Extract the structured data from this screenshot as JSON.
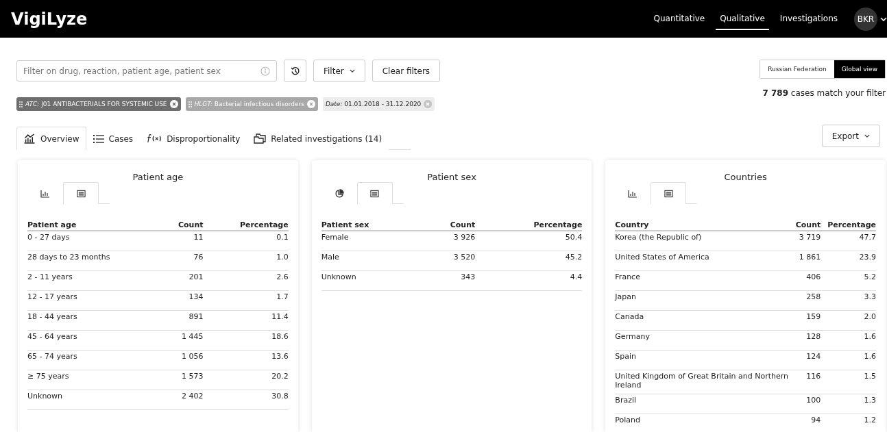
{
  "header": {
    "logo": "VigiLyze",
    "nav": [
      {
        "label": "Quantitative",
        "selected": false
      },
      {
        "label": "Qualitative",
        "selected": true
      },
      {
        "label": "Investigations",
        "selected": false
      }
    ],
    "avatar": "BKR"
  },
  "search": {
    "placeholder": "Filter on drug, reaction, patient age, patient sex"
  },
  "buttons": {
    "filter": "Filter",
    "clear": "Clear filters"
  },
  "scope": [
    {
      "label": "Russian Federation",
      "selected": false
    },
    {
      "label": "Global view",
      "selected": true
    }
  ],
  "match_count": "**7 789** cases match your filter",
  "chips": [
    {
      "prefix": "ATC:",
      "value": "J01 ANTIBACTERIALS FOR SYSTEMIC USE",
      "color": "#6e6e6e",
      "draggable": true
    },
    {
      "prefix": "HLGT:",
      "value": "Bacterial infectious disorders",
      "color": "#a8a8a8",
      "draggable": true
    },
    {
      "prefix": "Date:",
      "value": "01.01.2018 - 31.12.2020",
      "color": "#ececec",
      "draggable": false
    }
  ],
  "tabs": [
    {
      "kind": "overview",
      "label": "Overview",
      "selected": true
    },
    {
      "kind": "cases",
      "label": "Cases",
      "selected": false
    },
    {
      "kind": "function",
      "label": "Disproportionality",
      "selected": false
    },
    {
      "kind": "folders",
      "label": "Related investigations (14)",
      "selected": false
    }
  ],
  "export": "Export",
  "cards": [
    {
      "title": "Patient age",
      "views": [
        {
          "kind": "bar",
          "selected": false
        },
        {
          "kind": "table",
          "selected": true
        }
      ],
      "columns": [
        "Patient age",
        "Count",
        "Percentage"
      ],
      "rows": [
        [
          "0 - 27 days",
          "11",
          "0.1"
        ],
        [
          "28 days to 23 months",
          "76",
          "1.0"
        ],
        [
          "2 - 11 years",
          "201",
          "2.6"
        ],
        [
          "12 - 17 years",
          "134",
          "1.7"
        ],
        [
          "18 - 44 years",
          "891",
          "11.4"
        ],
        [
          "45 - 64 years",
          "1 445",
          "18.6"
        ],
        [
          "65 - 74 years",
          "1 056",
          "13.6"
        ],
        [
          "≥ 75 years",
          "1 573",
          "20.2"
        ],
        [
          "Unknown",
          "2 402",
          "30.8"
        ]
      ]
    },
    {
      "title": "Patient sex",
      "views": [
        {
          "kind": "pie",
          "selected": false
        },
        {
          "kind": "table",
          "selected": true
        }
      ],
      "columns": [
        "Patient sex",
        "Count",
        "Percentage"
      ],
      "rows": [
        [
          "Female",
          "3 926",
          "50.4"
        ],
        [
          "Male",
          "3 520",
          "45.2"
        ],
        [
          "Unknown",
          "343",
          "4.4"
        ]
      ]
    },
    {
      "title": "Countries",
      "views": [
        {
          "kind": "bar",
          "selected": false
        },
        {
          "kind": "table",
          "selected": true
        }
      ],
      "columns": [
        "Country",
        "Count",
        "Percentage"
      ],
      "rows": [
        [
          "Korea (the Republic of)",
          "3 719",
          "47.7"
        ],
        [
          "United States of America",
          "1 861",
          "23.9"
        ],
        [
          "France",
          "406",
          "5.2"
        ],
        [
          "Japan",
          "258",
          "3.3"
        ],
        [
          "Canada",
          "159",
          "2.0"
        ],
        [
          "Germany",
          "128",
          "1.6"
        ],
        [
          "Spain",
          "124",
          "1.6"
        ],
        [
          "United Kingdom of Great Britain and Northern Ireland",
          "116",
          "1.5"
        ],
        [
          "Brazil",
          "100",
          "1.3"
        ],
        [
          "Poland",
          "94",
          "1.2"
        ]
      ]
    }
  ]
}
